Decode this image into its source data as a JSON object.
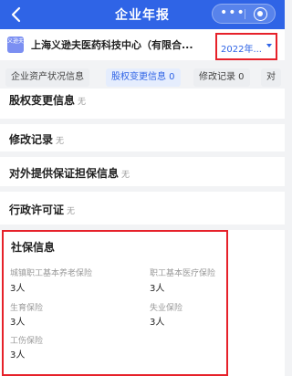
{
  "nav": {
    "title": "企业年报",
    "more_label": "•••"
  },
  "company": {
    "logo_text": "义逊夫",
    "name": "上海义逊夫医药科技中心（有限合...",
    "year": "2022年..."
  },
  "tabs": [
    {
      "label": "企业资产状况信息"
    },
    {
      "label": "股权变更信息 0"
    },
    {
      "label": "修改记录 0"
    },
    {
      "label": "对"
    }
  ],
  "sections": [
    {
      "title": "股权变更信息",
      "status": "无"
    },
    {
      "title": "修改记录",
      "status": "无"
    },
    {
      "title": "对外提供保证担保信息",
      "status": "无"
    },
    {
      "title": "行政许可证",
      "status": "无"
    }
  ],
  "social": {
    "title": "社保信息",
    "items": [
      {
        "label": "城镇职工基本养老保险",
        "value": "3人"
      },
      {
        "label": "职工基本医疗保险",
        "value": "3人"
      },
      {
        "label": "生育保险",
        "value": "3人"
      },
      {
        "label": "失业保险",
        "value": "3人"
      },
      {
        "label": "工伤保险",
        "value": "3人"
      }
    ]
  },
  "colors": {
    "brand": "#2f64e6",
    "highlight": "#e6212a"
  }
}
